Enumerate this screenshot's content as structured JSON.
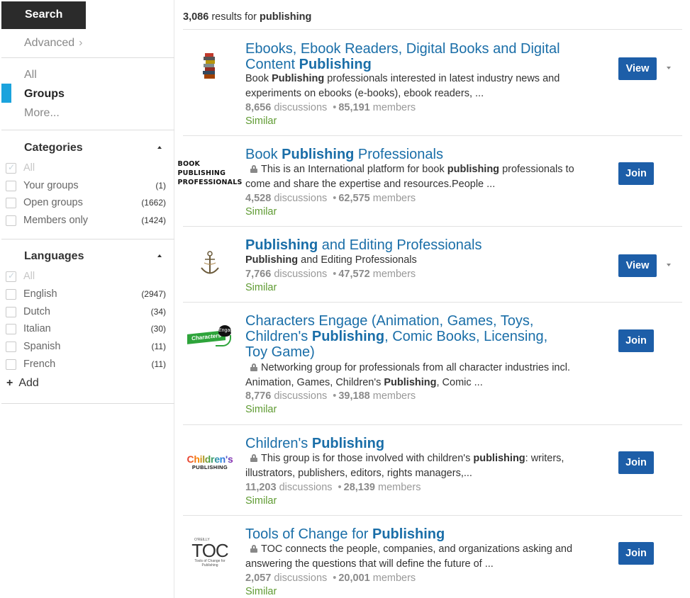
{
  "sidebar": {
    "search_tab": "Search",
    "advanced": "Advanced",
    "nav": [
      "All",
      "Groups",
      "More..."
    ],
    "categories": {
      "title": "Categories",
      "items": [
        {
          "label": "All",
          "count": ""
        },
        {
          "label": "Your groups",
          "count": "(1)"
        },
        {
          "label": "Open groups",
          "count": "(1662)"
        },
        {
          "label": "Members only",
          "count": "(1424)"
        }
      ]
    },
    "languages": {
      "title": "Languages",
      "items": [
        {
          "label": "All",
          "count": ""
        },
        {
          "label": "English",
          "count": "(2947)"
        },
        {
          "label": "Dutch",
          "count": "(34)"
        },
        {
          "label": "Italian",
          "count": "(30)"
        },
        {
          "label": "Spanish",
          "count": "(11)"
        },
        {
          "label": "French",
          "count": "(11)"
        }
      ]
    },
    "add_label": "Add"
  },
  "results": {
    "count": "3,086",
    "label_mid": " results for ",
    "query": "publishing",
    "groups": [
      {
        "title_parts": [
          "Ebooks, Ebook Readers, Digital Books and Digital Content ",
          "Publishing",
          ""
        ],
        "desc_parts": [
          "Book ",
          "Publishing",
          " professionals interested in latest industry news and experiments on ebooks (e-books), ebook readers, ..."
        ],
        "discussions": "8,656",
        "discussions_label": " discussions",
        "members": "85,191",
        "members_label": " members",
        "similar": "Similar",
        "action": "View",
        "locked": false
      },
      {
        "title_parts": [
          "Book ",
          "Publishing",
          " Professionals"
        ],
        "logo_text": "BOOK\nPUBLISHING\nPROFESSIONALS",
        "desc_parts": [
          "This is an International platform for book ",
          "publishing",
          " professionals to come and share the expertise and resources.People ..."
        ],
        "discussions": "4,528",
        "discussions_label": " discussions",
        "members": "62,575",
        "members_label": " members",
        "similar": "Similar",
        "action": "Join",
        "locked": true
      },
      {
        "title_parts": [
          "",
          "Publishing",
          " and Editing Professionals"
        ],
        "desc_parts": [
          "",
          "Publishing",
          " and Editing Professionals"
        ],
        "discussions": "7,766",
        "discussions_label": " discussions",
        "members": "47,572",
        "members_label": " members",
        "similar": "Similar",
        "action": "View",
        "locked": false
      },
      {
        "title_parts": [
          "Characters Engage (Animation, Games, Toys, Children's ",
          "Publishing",
          ", Comic Books, Licensing, Toy Game)"
        ],
        "logo_text": "Characters",
        "logo_badge": "Engage",
        "desc_parts": [
          "Networking group for professionals from all character industries incl. Animation, Games, Children's ",
          "Publishing",
          ", Comic ..."
        ],
        "discussions": "8,776",
        "discussions_label": " discussions",
        "members": "39,188",
        "members_label": " members",
        "similar": "Similar",
        "action": "Join",
        "locked": true
      },
      {
        "title_parts": [
          "Children's ",
          "Publishing",
          ""
        ],
        "logo_text": "Children's",
        "logo_sub": "PUBLISHING",
        "desc_parts": [
          "This group is for those involved with children's ",
          "publishing",
          ": writers, illustrators, publishers, editors, rights managers,..."
        ],
        "discussions": "11,203",
        "discussions_label": " discussions",
        "members": "28,139",
        "members_label": " members",
        "similar": "Similar",
        "action": "Join",
        "locked": true
      },
      {
        "title_parts": [
          "Tools of Change for ",
          "Publishing",
          ""
        ],
        "logo_small": "O'REILLY",
        "logo_text": "TOC",
        "logo_sub": "Tools of Change for Publishing",
        "desc_parts": [
          "TOC connects the people, companies, and organizations asking and answering the questions that will define the future of ..."
        ],
        "discussions": "2,057",
        "discussions_label": " discussions",
        "members": "20,001",
        "members_label": " members",
        "similar": "Similar",
        "action": "Join",
        "locked": true
      }
    ]
  },
  "colors": {
    "accent": "#1ba3dd",
    "link": "#1a6ea8",
    "button": "#1d5ea8",
    "similar": "#5f9b32",
    "search_tab": "#2b2b2b"
  }
}
